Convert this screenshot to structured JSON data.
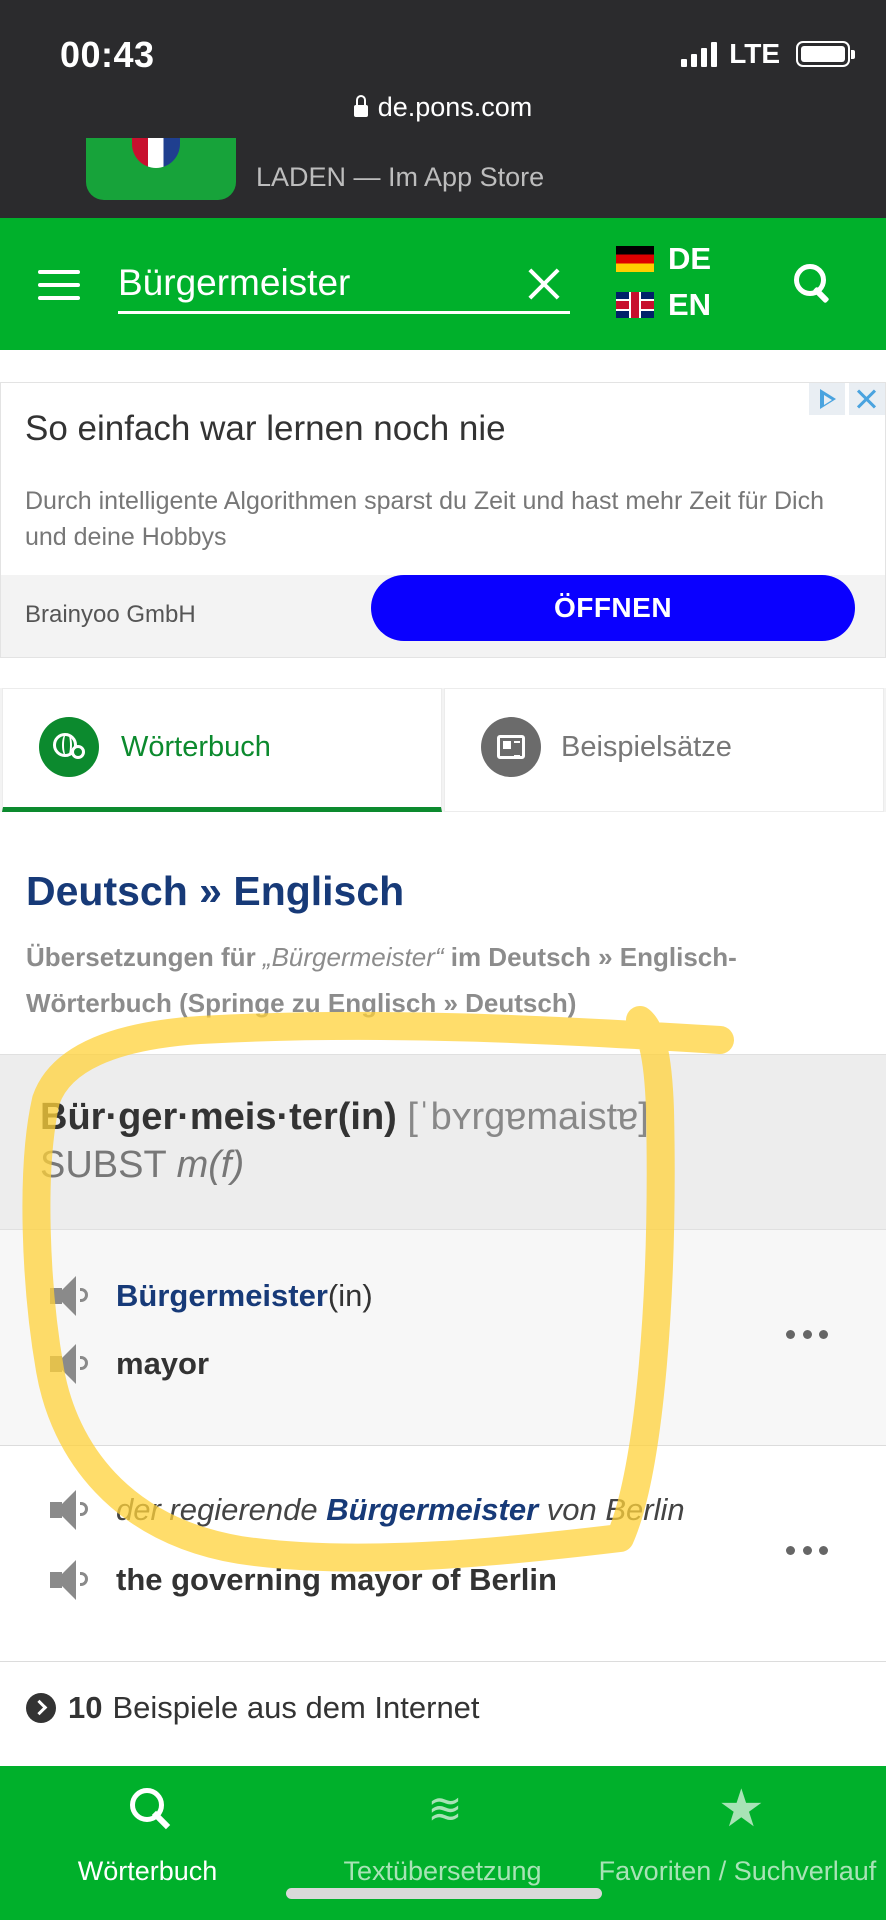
{
  "status": {
    "time": "00:43",
    "network": "LTE",
    "url": "de.pons.com"
  },
  "app_banner": {
    "text": "LADEN — Im App Store"
  },
  "search": {
    "value": "Bürgermeister",
    "source_lang": "DE",
    "target_lang": "EN"
  },
  "ad": {
    "title": "So einfach war lernen noch nie",
    "description": "Durch intelligente Algorithmen sparst du Zeit und hast mehr Zeit für Dich und deine Hobbys",
    "sponsor": "Brainyoo GmbH",
    "button": "ÖFFNEN"
  },
  "tabs": [
    {
      "label": "Wörterbuch",
      "active": true,
      "icon": "globe-search-icon"
    },
    {
      "label": "Beispielsätze",
      "active": false,
      "icon": "newspaper-icon"
    }
  ],
  "dictionary": {
    "title": "Deutsch » Englisch",
    "subtitle_part1": "Übersetzungen für ",
    "subtitle_term": "„Bürgermeister“",
    "subtitle_part2": " im Deutsch » Englisch-Wörterbuch (Springe zu Englisch » Deutsch)",
    "entry": {
      "headword": "Bür·ger·meis·ter(in)",
      "phonetic": "[ˈbʏrgɐmaistɐ]",
      "word_class": "SUBST",
      "gender": "m(f)"
    },
    "translations": [
      {
        "source_word": "Bürgermeister",
        "source_rest": "(in)",
        "target": "mayor"
      }
    ],
    "example": {
      "source_before": "der regierende ",
      "source_term": "Bürgermeister",
      "source_after": " von Berlin",
      "target": "the governing mayor of Berlin"
    },
    "web_examples": {
      "count": "10",
      "label": "Beispiele aus dem Internet"
    }
  },
  "bottom_nav": [
    {
      "label": "Wörterbuch",
      "icon": "search-icon",
      "active": true
    },
    {
      "label": "Textübersetzung",
      "icon": "waves-icon",
      "active": false
    },
    {
      "label": "Favoriten / Suchverlauf",
      "icon": "star-icon",
      "active": false
    }
  ],
  "colors": {
    "brand_green": "#00b02b",
    "link_blue": "#173a78",
    "ad_button": "#0a00ff",
    "highlight": "#ffd23a"
  }
}
